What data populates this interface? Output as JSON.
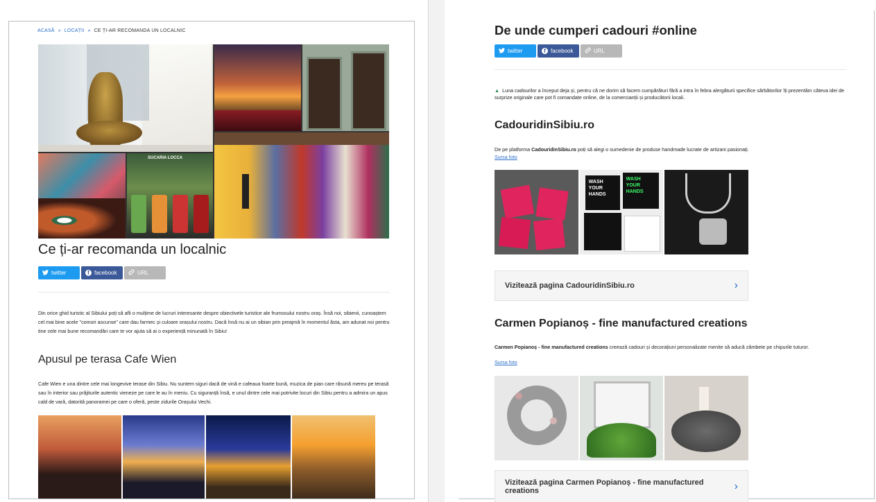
{
  "left": {
    "breadcrumb": {
      "home": "ACASĂ",
      "sep": "»",
      "cat": "LOCAȚII",
      "current": "CE ȚI-AR RECOMANDA UN LOCALNIC"
    },
    "title": "Ce ți-ar recomanda un localnic",
    "share": {
      "twitter": "twitter",
      "facebook": "facebook",
      "url": "URL"
    },
    "intro": "Din orice ghid turistic al Sibiului poți să afli o mulțime de lucruri interesante despre obiectivele turistice ale frumosului nostru oraș. Însă noi, sibienii, cunoaștem cel mai bine acele \"comori ascunse\" care dau farmec și culoare orașului nostru. Dacă însă nu ai un sibian prin preajmă în momentul ăsta, am adunat noi pentru tine cele mai bune recomandări care te vor ajuta să ai o experiență minunată în Sibiu!",
    "section1_title": "Apusul pe terasa Cafe Wien",
    "section1_text": "Cafe Wien e una dintre cele mai longevive terase din Sibiu. Nu suntem siguri dacă de vină e cafeaua foarte bună, muzica de pian care răsună mereu pe terasă sau în interior sau prăjiturile autentic vieneze pe care le au în meniu. Cu siguranță însă, e unul dintre cele mai potrivite locuri din Sibiu pentru a admira un apus cald de vară, datorită panoramei pe care o oferă, peste zidurile Orașului Vechi.",
    "juice_sign": "SUCARIA LOCCA"
  },
  "right": {
    "title": "De unde cumperi cadouri #online",
    "share": {
      "twitter": "twitter",
      "facebook": "facebook",
      "url": "URL"
    },
    "intro": "Luna cadourilor a început deja și, pentru că ne dorim să facem cumpărături fără a intra în febra alergăturii specifice sărbătorilor îți prezentăm câteva idei de surprize originale care pot fi comandate online, de la comercianții și producătorii locali.",
    "shop1": {
      "name": "CadouridinSibiu.ro",
      "text_pre": "De pe platforma ",
      "text_bold": "CadouridinSibiu.ro",
      "text_post": " poți să alegi o sumedenie de produse handmade lucrate de artizani pasionați.",
      "source": "Sursa foto",
      "mug_text": "WASH YOUR HANDS",
      "visit": "Vizitează pagina CadouridinSibiu.ro"
    },
    "shop2": {
      "name": "Carmen Popianoș - fine manufactured creations",
      "text_bold": "Carmen Popianoș - fine manufactured creations",
      "text_post": " creează cadouri și decorațiuni personalizate menite să aducă zâmbete pe chipurile tuturor.",
      "source": "Sursa foto",
      "visit": "Vizitează pagina Carmen Popianoș - fine manufactured creations"
    }
  },
  "colors": {
    "link": "#2a6fc9",
    "twitter": "#1d9bf0",
    "facebook": "#3b5998",
    "url": "#b8b8b8"
  }
}
